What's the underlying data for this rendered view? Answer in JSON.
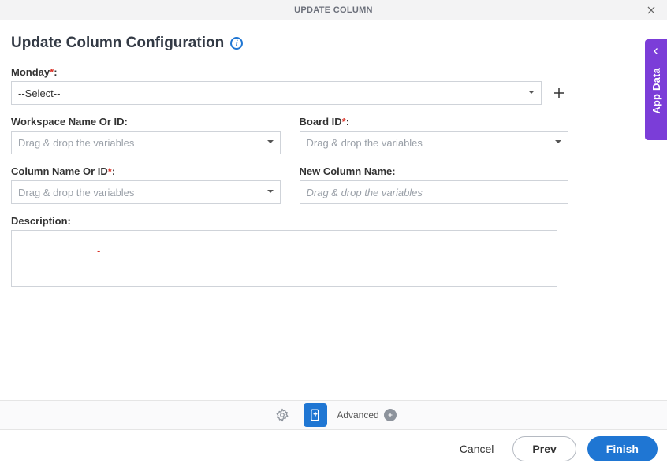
{
  "header": {
    "title": "UPDATE COLUMN"
  },
  "section": {
    "title": "Update Column Configuration"
  },
  "sideTab": {
    "label": "App Data"
  },
  "fields": {
    "monday": {
      "label": "Monday",
      "selected": "--Select--"
    },
    "workspace": {
      "label": "Workspace Name Or ID:",
      "placeholder": "Drag & drop the variables"
    },
    "board": {
      "label": "Board ID",
      "placeholder": "Drag & drop the variables"
    },
    "column": {
      "label": "Column Name Or ID",
      "placeholder": "Drag & drop the variables"
    },
    "newColumn": {
      "label": "New Column Name:",
      "placeholder": "Drag & drop the variables"
    },
    "description": {
      "label": "Description:",
      "placeholder": "-"
    }
  },
  "toolbar": {
    "advanced": "Advanced"
  },
  "footer": {
    "cancel": "Cancel",
    "prev": "Prev",
    "finish": "Finish"
  }
}
